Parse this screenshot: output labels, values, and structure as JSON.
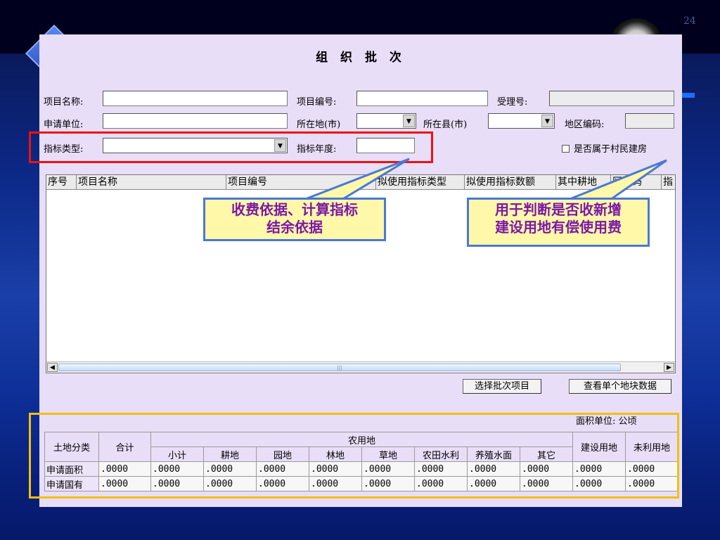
{
  "slide": {
    "number": "24"
  },
  "dialog": {
    "title": "组 织 批 次",
    "fields": {
      "project_name": {
        "label": "项目名称:",
        "value": ""
      },
      "project_code": {
        "label": "项目编号:",
        "value": ""
      },
      "accept_no": {
        "label": "受理号:",
        "value": ""
      },
      "applicant": {
        "label": "申请单位:",
        "value": ""
      },
      "city": {
        "label": "所在地(市)",
        "value": ""
      },
      "county": {
        "label": "所在县(市)",
        "value": ""
      },
      "region_code": {
        "label": "地区编码:",
        "value": ""
      },
      "quota_type": {
        "label": "指标类型:",
        "value": ""
      },
      "quota_year": {
        "label": "指标年度:",
        "value": ""
      },
      "village_house": {
        "label": "是否属于村民建房",
        "checked": false
      }
    },
    "grid": {
      "columns": [
        "序号",
        "项目名称",
        "项目编号",
        "拟使用指标类型",
        "拟使用指标数额",
        "其中耕地",
        "区编码",
        "指"
      ],
      "rows": []
    },
    "buttons": {
      "select_batch": "选择批次项目",
      "view_parcel": "查看单个地块数据"
    },
    "area_unit": "面积单位: 公顷",
    "land_table": {
      "header_land_class": "土地分类",
      "header_total": "合计",
      "header_agri": "农用地",
      "header_construction": "建设用地",
      "header_unused": "未利用地",
      "agri_subcols": [
        "小计",
        "耕地",
        "园地",
        "林地",
        "草地",
        "农田水利",
        "养殖水面",
        "其它"
      ],
      "rows": [
        {
          "label": "申请面积",
          "values": [
            ".0000",
            ".0000",
            ".0000",
            ".0000",
            ".0000",
            ".0000",
            ".0000",
            ".0000",
            ".0000",
            ".0000",
            ".0000"
          ]
        },
        {
          "label": "申请国有",
          "values": [
            ".0000",
            ".0000",
            ".0000",
            ".0000",
            ".0000",
            ".0000",
            ".0000",
            ".0000",
            ".0000",
            ".0000",
            ".0000"
          ]
        }
      ]
    }
  },
  "callouts": {
    "left": [
      "收费依据、计算指标",
      "结余依据"
    ],
    "right": [
      "用于判断是否收新增",
      "建设用地有偿使用费"
    ]
  },
  "colors": {
    "dialog_bg": "#e8def8",
    "red_highlight": "#ee1111",
    "yellow_highlight": "#f2c010",
    "callout_fill": "#fff8a8",
    "callout_text": "#7a18a8",
    "callout_border": "#4a78d8"
  }
}
